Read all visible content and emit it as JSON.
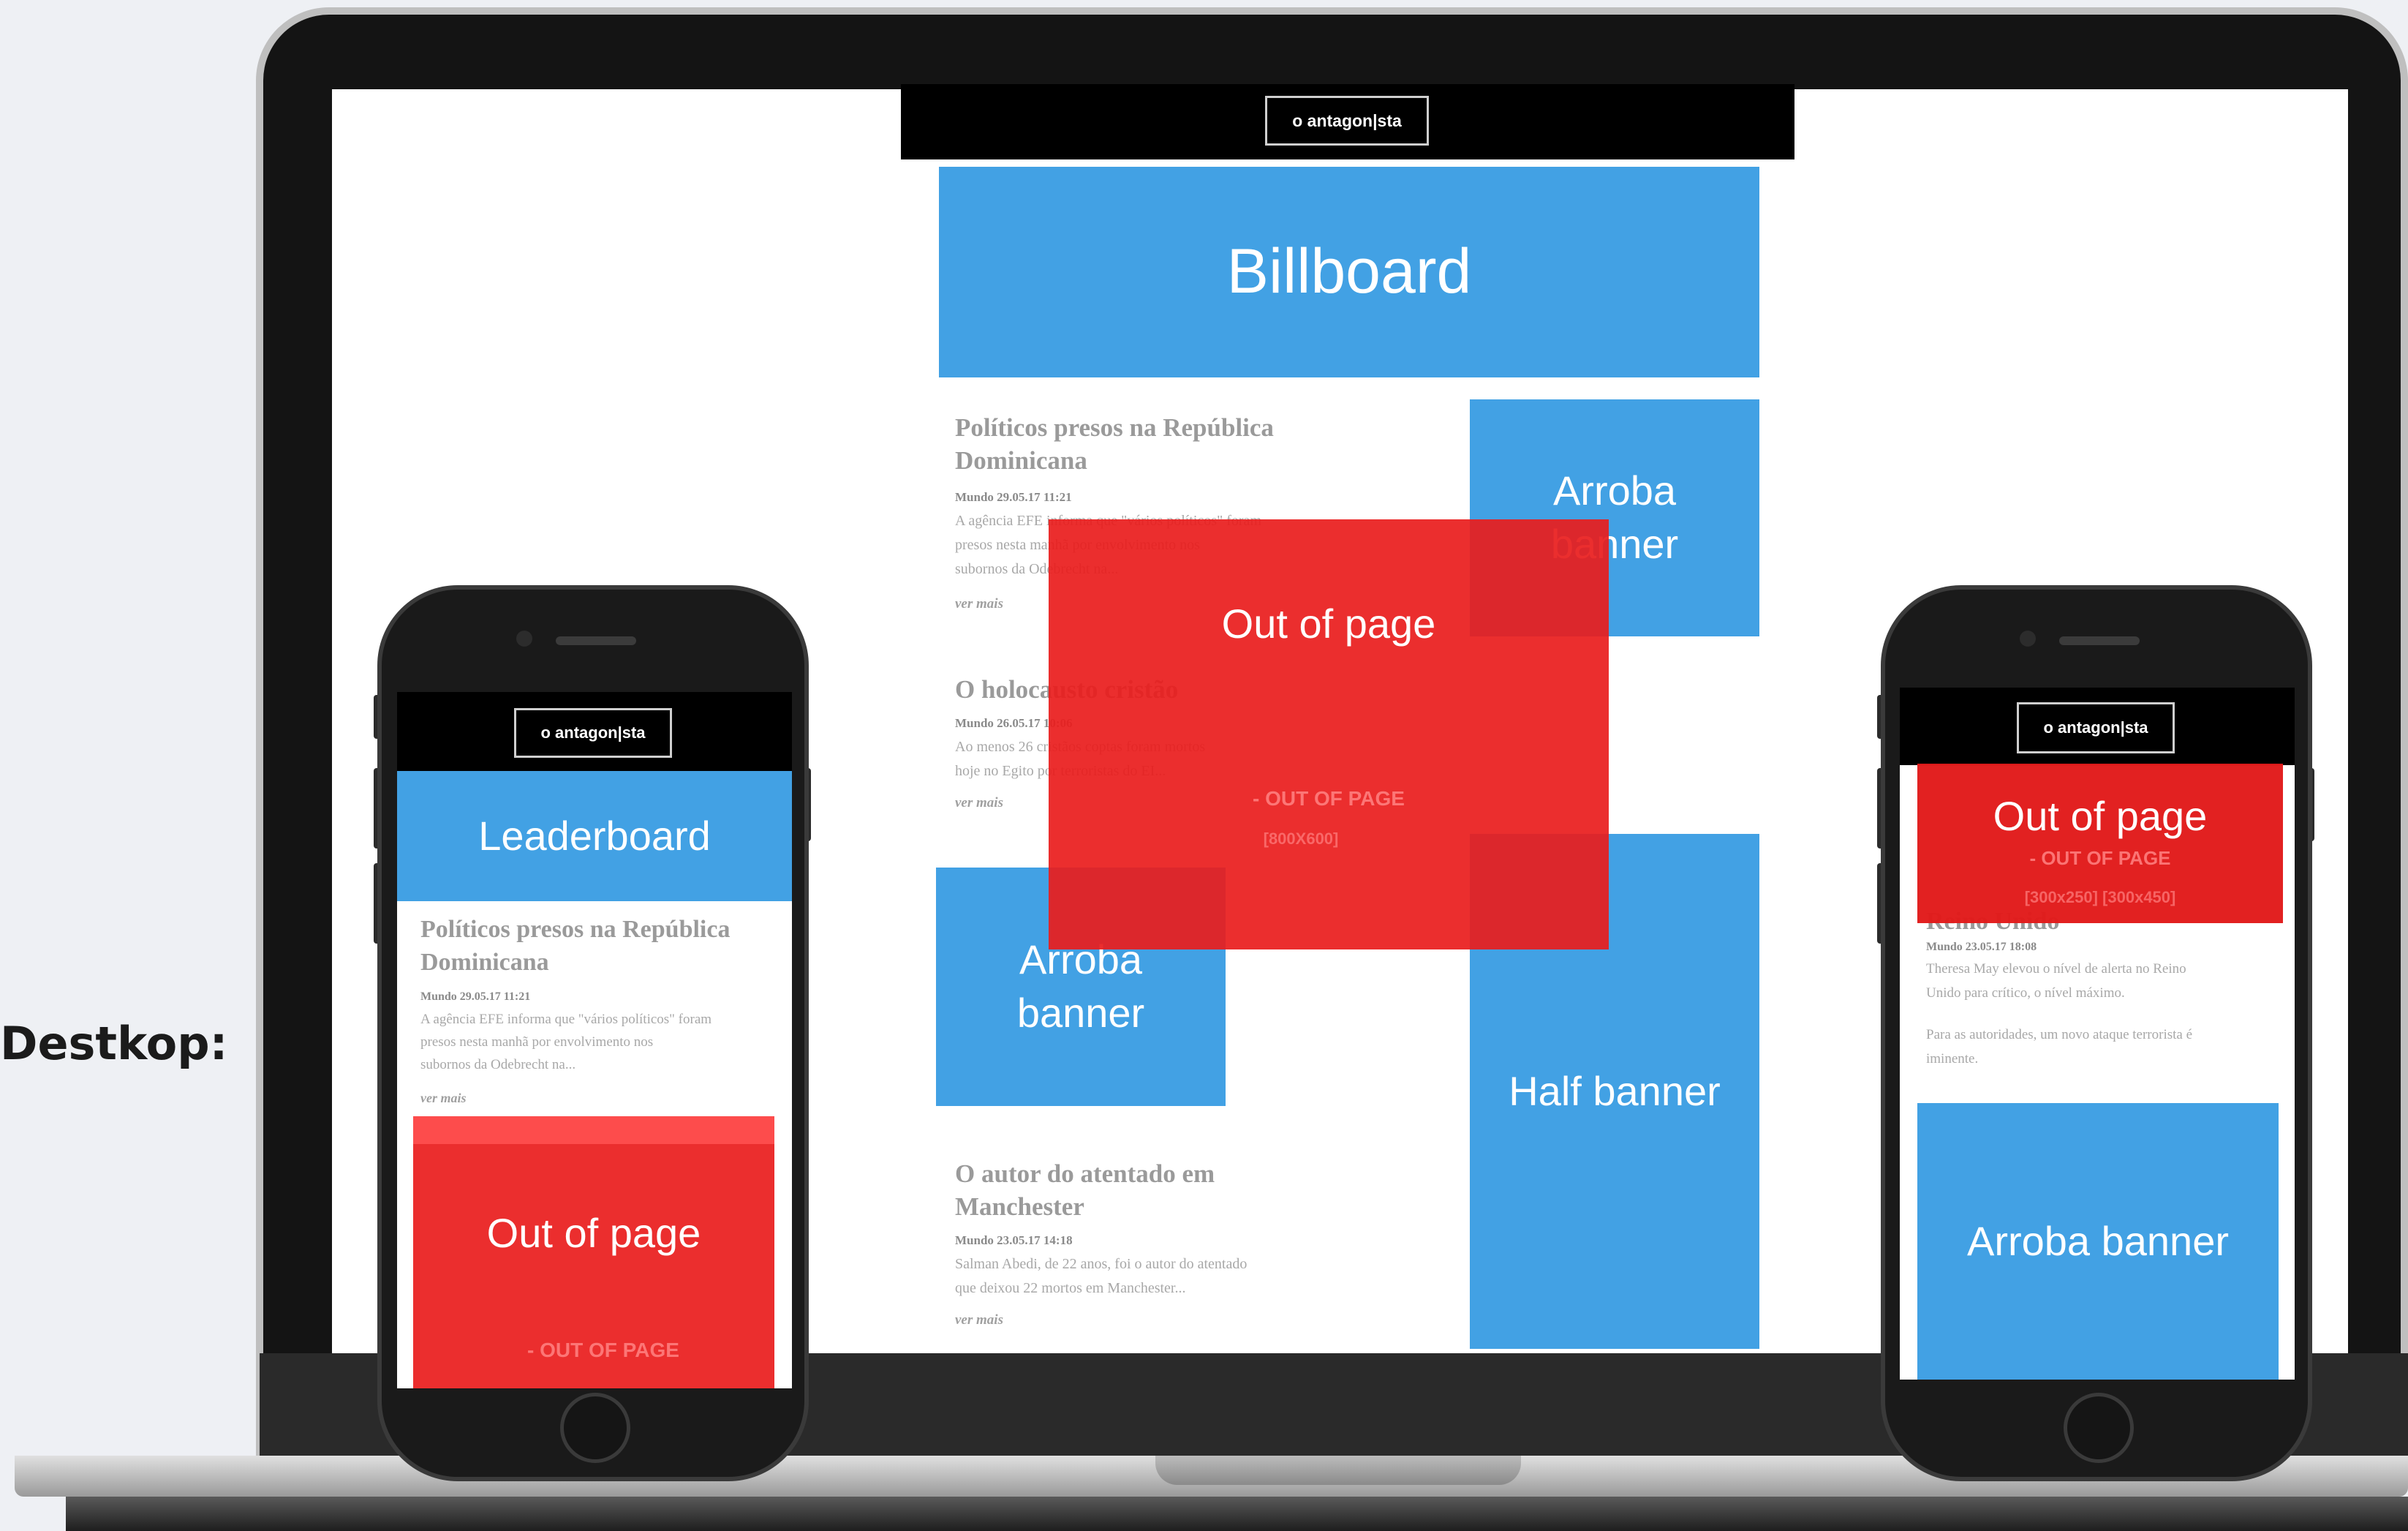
{
  "caption": "Destkop:",
  "brand": {
    "logo_text": "o antagon|sta"
  },
  "desktop": {
    "ads": {
      "billboard": "Billboard",
      "arroba_top_line1": "Arroba",
      "arroba_top_line2": "banner",
      "out_of_page": "Out of page",
      "out_of_page_tag": "- OUT OF PAGE",
      "out_of_page_size": "[800X600]",
      "arroba_left_line1": "Arroba",
      "arroba_left_line2": "banner",
      "half_banner": "Half banner"
    },
    "articles": [
      {
        "title_line1": "Políticos presos na República",
        "title_line2": "Dominicana",
        "meta": "Mundo 29.05.17 11:21",
        "body_line1": "A agência EFE informa que \"vários políticos\" foram",
        "body_line2": "presos nesta manhã por envolvimento nos",
        "body_line3": "subornos da Odebrecht na...",
        "more": "ver mais"
      },
      {
        "title_line1": "O holocausto cristão",
        "meta": "Mundo 26.05.17 10:06",
        "body_line1": "Ao menos 26 cristãos coptas foram mortos",
        "body_line2": "hoje no Egito por terroristas do EI...",
        "more": "ver mais"
      },
      {
        "title_line1": "O autor do atentado em",
        "title_line2": "Manchester",
        "meta": "Mundo 23.05.17 14:18",
        "body_line1": "Salman Abedi, de 22 anos, foi o autor do atentado",
        "body_line2": "que deixou 22 mortos em Manchester...",
        "more": "ver mais"
      }
    ]
  },
  "phone_left": {
    "leaderboard": "Leaderboard",
    "article": {
      "title_line1": "Políticos presos na República",
      "title_line2": "Dominicana",
      "meta": "Mundo 29.05.17 11:21",
      "body_line1": "A agência EFE informa que \"vários políticos\" foram",
      "body_line2": "presos nesta manhã por envolvimento nos",
      "body_line3": "subornos da Odebrecht na...",
      "more": "ver mais"
    },
    "out_of_page": "Out of page",
    "out_of_page_tag": "- OUT OF PAGE"
  },
  "phone_right": {
    "out_of_page": "Out of page",
    "out_of_page_tag": "- OUT OF PAGE",
    "out_of_page_size": "[300x250] [300x450]",
    "article": {
      "title_line1": "Reino Unido",
      "meta": "Mundo 23.05.17 18:08",
      "body_line1": "Theresa May elevou o nível de alerta no Reino",
      "body_line2": "Unido para crítico, o nível máximo.",
      "body_line3": "Para as autoridades, um novo ataque terrorista é",
      "body_line4": "iminente."
    },
    "arroba_banner": "Arroba banner"
  }
}
